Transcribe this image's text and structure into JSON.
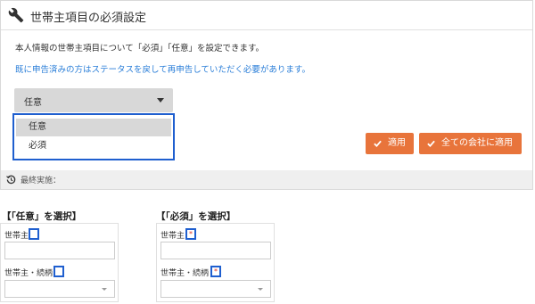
{
  "panel": {
    "title": "世帯主項目の必須設定",
    "description": "本人情報の世帯主項目について「必須」「任意」を設定できます。",
    "info": "既に申告済みの方はステータスを戻して再申告していただく必要があります。",
    "select": {
      "value": "任意",
      "options": [
        "任意",
        "必須"
      ]
    },
    "buttons": {
      "apply": "適用",
      "apply_all": "全ての会社に適用"
    },
    "last_run_label": "最終実施：",
    "accent_color": "#e8743b",
    "highlight_color": "#1f5fcf"
  },
  "examples": [
    {
      "title": "【「任意」を選択】",
      "field1": "世帯主",
      "field2": "世帯主・続柄",
      "required": false
    },
    {
      "title": "【「必須」を選択】",
      "field1": "世帯主",
      "field2": "世帯主・続柄",
      "required": true
    }
  ],
  "required_mark": "*"
}
